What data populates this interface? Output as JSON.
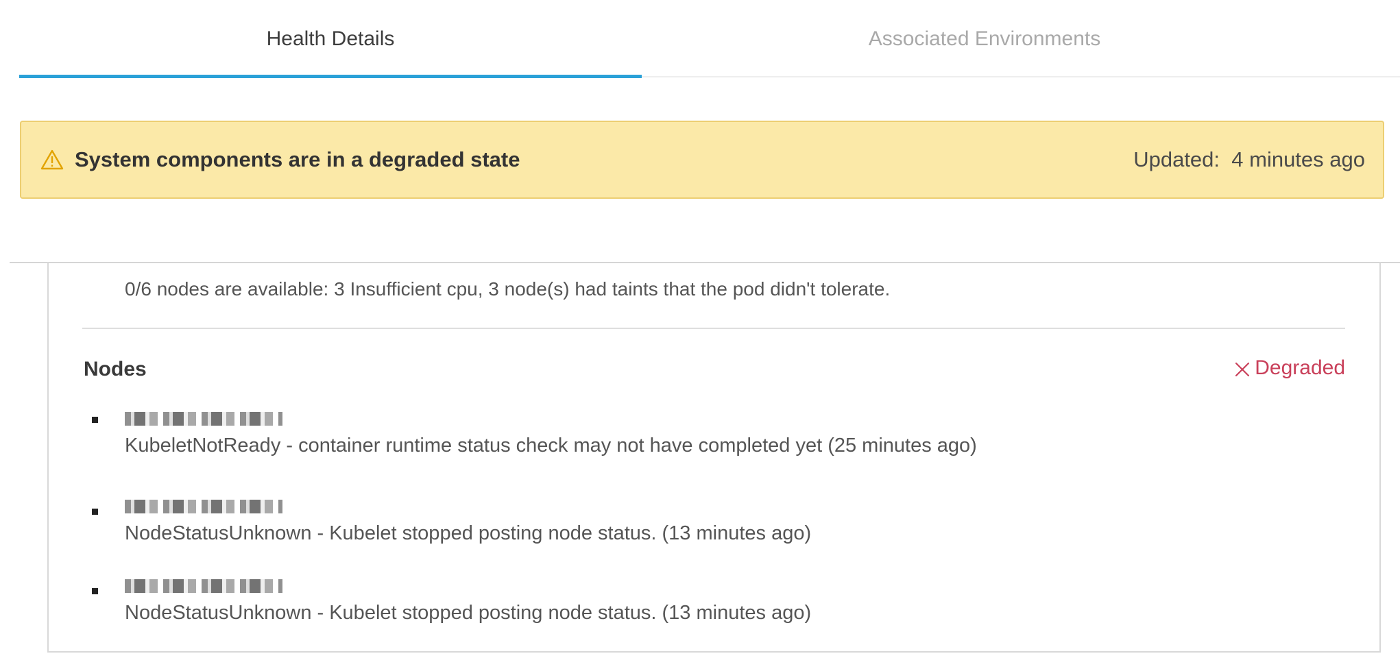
{
  "tabs": [
    {
      "label": "Health Details",
      "active": true
    },
    {
      "label": "Associated Environments",
      "active": false
    }
  ],
  "alert": {
    "icon": "warning-triangle-icon",
    "title": "System components are in a degraded state",
    "updated_label": "Updated:",
    "updated_value": "4 minutes ago",
    "background_color": "#fbe9a8",
    "border_color": "#ecce72"
  },
  "health": {
    "previous_message": "0/6 nodes are available: 3 Insufficient cpu, 3 node(s) had taints that the pod didn't tolerate.",
    "nodes_section": {
      "title": "Nodes",
      "status_icon": "x-icon",
      "status": "Degraded",
      "status_color": "#c9405a",
      "items": [
        {
          "message": "KubeletNotReady - container runtime status check may not have completed yet (25 minutes ago)"
        },
        {
          "message": "NodeStatusUnknown - Kubelet stopped posting node status. (13 minutes ago)"
        },
        {
          "message": "NodeStatusUnknown - Kubelet stopped posting node status. (13 minutes ago)"
        }
      ]
    }
  },
  "colors": {
    "accent": "#2aa1d8"
  }
}
